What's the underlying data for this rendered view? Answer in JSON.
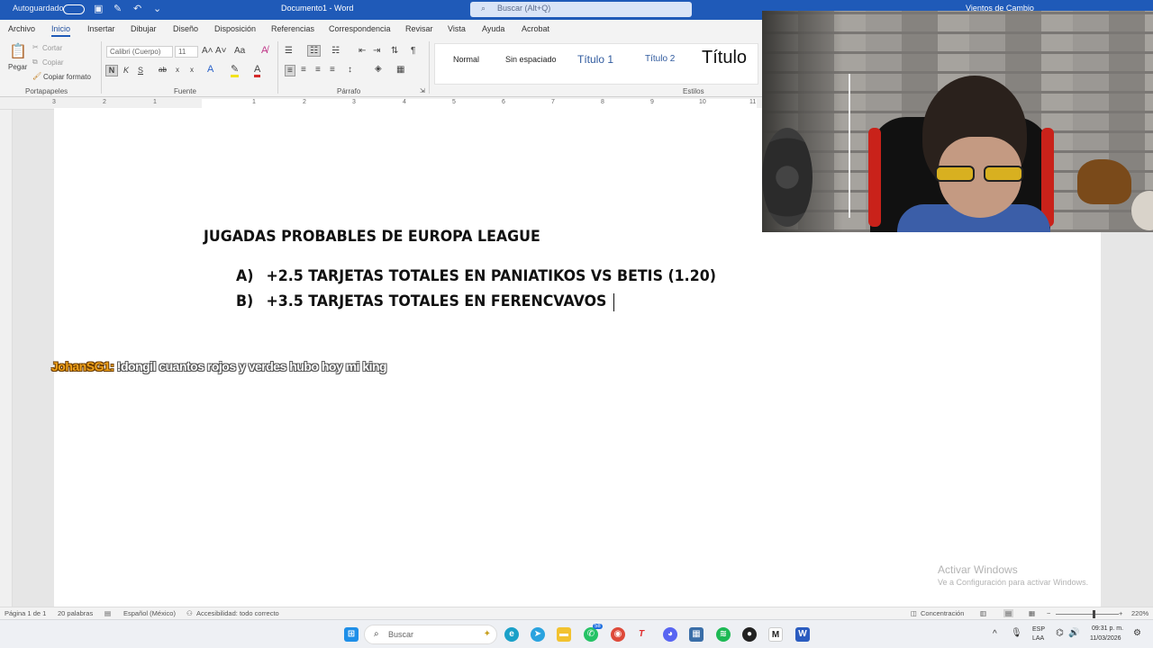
{
  "titlebar": {
    "autosave": "Autoguardado",
    "doc_title": "Documento1 - Word",
    "search_placeholder": "Buscar (Alt+Q)",
    "user_name": "Vientos de Cambio"
  },
  "menu": {
    "tabs": [
      "Archivo",
      "Inicio",
      "Insertar",
      "Dibujar",
      "Diseño",
      "Disposición",
      "Referencias",
      "Correspondencia",
      "Revisar",
      "Vista",
      "Ayuda",
      "Acrobat"
    ],
    "active_tab": "Inicio"
  },
  "ribbon": {
    "clipboard": {
      "paste": "Pegar",
      "cut": "Cortar",
      "copy": "Copiar",
      "format_painter": "Copiar formato",
      "label": "Portapapeles"
    },
    "font": {
      "font_name": "Calibri (Cuerpo)",
      "font_size": "11",
      "bold": "N",
      "italic": "K",
      "underline": "S",
      "strike": "ab",
      "subscript": "x",
      "superscript": "x",
      "label": "Fuente"
    },
    "paragraph": {
      "label": "Párrafo"
    },
    "styles": {
      "items": [
        "Normal",
        "Sin espaciado",
        "Título 1",
        "Título 2",
        "Título"
      ],
      "label": "Estilos"
    }
  },
  "ruler": {
    "numbers": [
      "3",
      "2",
      "1",
      "1",
      "2",
      "3",
      "4",
      "5",
      "6",
      "7",
      "8",
      "9",
      "10",
      "11"
    ]
  },
  "document": {
    "title": "JUGADAS PROBABLES DE EUROPA LEAGUE",
    "items": [
      {
        "marker": "A)",
        "text": "+2.5 TARJETAS TOTALES EN PANIATIKOS VS BETIS (1.20)"
      },
      {
        "marker": "B)",
        "text": "+3.5 TARJETAS TOTALES EN FERENCVAVOS"
      }
    ]
  },
  "chat": {
    "user": "JohanSG1:",
    "message": "!dongil cuantos rojos y verdes hubo hoy mi king"
  },
  "activation": {
    "title": "Activar Windows",
    "subtitle": "Ve a Configuración para activar Windows."
  },
  "statusbar": {
    "page": "Página 1 de 1",
    "words": "20 palabras",
    "language": "Español (México)",
    "accessibility": "Accesibilidad: todo correcto",
    "focus": "Concentración",
    "zoom": "220%"
  },
  "taskbar": {
    "search_placeholder": "Buscar",
    "badge": "58",
    "lang_top": "ESP",
    "lang_bottom": "LAA",
    "time": "09:31 p. m.",
    "date": "11/03/2026"
  },
  "colors": {
    "accent": "#1f5ab8",
    "chat_user": "#f0a21b"
  }
}
